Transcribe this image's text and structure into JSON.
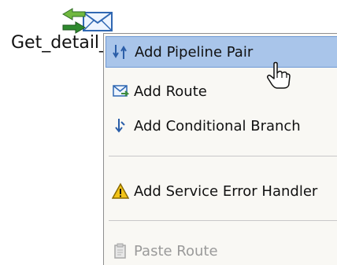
{
  "node": {
    "label": "Get_detail_",
    "icon": "pipeline-envelope-icon"
  },
  "menu": {
    "items": [
      {
        "label": "Add Pipeline Pair",
        "icon": "pipeline-pair-icon",
        "state": "selected"
      },
      {
        "label": "Add Route",
        "icon": "route-icon",
        "state": "normal"
      },
      {
        "label": "Add Conditional Branch",
        "icon": "conditional-branch-icon",
        "state": "normal"
      },
      {
        "label": "Add Service Error Handler",
        "icon": "warning-icon",
        "state": "normal"
      },
      {
        "label": "Paste Route",
        "icon": "paste-icon",
        "state": "disabled"
      }
    ]
  },
  "colors": {
    "selection": "#a9c5ea",
    "selection_border": "#6f99d4",
    "menu_background": "#f9f8f4",
    "disabled_text": "#9a9a9a"
  },
  "cursor": "hand-pointer-icon"
}
